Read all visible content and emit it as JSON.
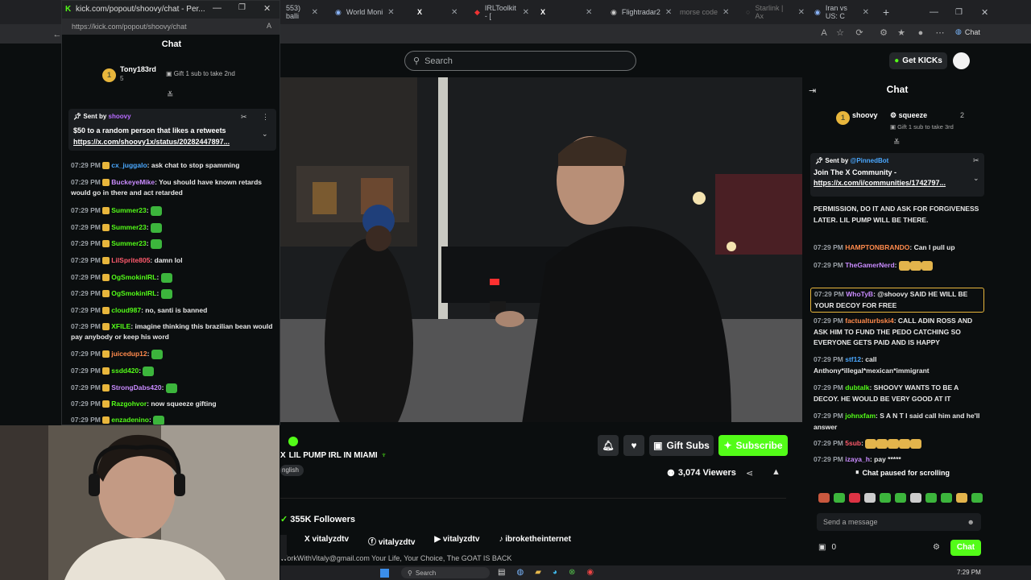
{
  "browser": {
    "tabs": [
      {
        "label": "553) balli",
        "left": 0
      },
      {
        "label": "World Moni",
        "left": 0
      },
      {
        "label": "X",
        "left": 0
      },
      {
        "label": "IRLToolkit - [",
        "left": 0
      },
      {
        "label": "X",
        "left": 0
      },
      {
        "label": "Flightradar2",
        "left": 0
      },
      {
        "label": "morse code",
        "left": 0
      },
      {
        "label": "Starlink | Ax",
        "left": 0
      },
      {
        "label": "Iran vs US: C",
        "left": 0
      }
    ],
    "new_tab": "+",
    "copilot_label": "Chat"
  },
  "popout": {
    "window_title": "kick.com/popout/shoovy/chat - Per...",
    "url": "https://kick.com/popout/shoovy/chat",
    "header": "Chat",
    "gifter": {
      "rank": "1",
      "name": "Tony183rd",
      "count": "5",
      "gift_text": "Gift 1 sub to take 2nd"
    },
    "pinned": {
      "sent_by": "Sent by",
      "sender": "shoovy",
      "message": "$50 to a random person that likes a retweets",
      "link": "https://x.com/shoovy1x/status/20282447897..."
    },
    "messages": [
      {
        "time": "07:29 PM",
        "user": "cx_juggalo",
        "text": "ask chat to stop spamming",
        "color": "b"
      },
      {
        "time": "07:29 PM",
        "user": "BuckeyeMike",
        "text": "You should have known retards would go in there and act retarded",
        "color": "p"
      },
      {
        "time": "07:29 PM",
        "user": "Summer23",
        "text": "",
        "color": "g"
      },
      {
        "time": "07:29 PM",
        "user": "Summer23",
        "text": "",
        "color": "g"
      },
      {
        "time": "07:29 PM",
        "user": "Summer23",
        "text": "",
        "color": "g"
      },
      {
        "time": "07:29 PM",
        "user": "LilSprite805",
        "text": "damn lol",
        "color": "r"
      },
      {
        "time": "07:29 PM",
        "user": "OgSmokinIRL",
        "text": "",
        "color": "g"
      },
      {
        "time": "07:29 PM",
        "user": "OgSmokinIRL",
        "text": "",
        "color": "g"
      },
      {
        "time": "07:29 PM",
        "user": "cloud987",
        "text": "no, santi is banned",
        "color": "g"
      },
      {
        "time": "07:29 PM",
        "user": "XFILE",
        "text": "imagine thinking this brazilian bean would pay anybody or keep his word",
        "color": "g"
      },
      {
        "time": "07:29 PM",
        "user": "juicedup12",
        "text": "",
        "color": "o"
      },
      {
        "time": "07:29 PM",
        "user": "ssdd420",
        "text": "",
        "color": "g"
      },
      {
        "time": "07:29 PM",
        "user": "StrongDabs420",
        "text": "",
        "color": "p"
      },
      {
        "time": "07:29 PM",
        "user": "Razgohvor",
        "text": "now squeeze gifting",
        "color": "g"
      },
      {
        "time": "07:29 PM",
        "user": "enzadenino",
        "text": "",
        "color": "g"
      }
    ]
  },
  "kick": {
    "search_placeholder": "Search",
    "get_kicks": "Get KICKs"
  },
  "stream": {
    "title": "LIL PUMP IRL IN MIAMI",
    "tag": "nglish",
    "buttons": {
      "gift_subs": "Gift Subs",
      "subscribe": "Subscribe"
    },
    "viewers": "3,074 Viewers",
    "followers": "355K Followers",
    "socials": [
      {
        "label": "vitalyzdtv",
        "icon": "x-icon"
      },
      {
        "label": "vitalyzdtv",
        "icon": "facebook-icon"
      },
      {
        "label": "vitalyzdtv",
        "icon": "youtube-icon"
      },
      {
        "label": "ibroketheinternet",
        "icon": "tiktok-icon"
      }
    ],
    "bio": "WorkWithVitaly@gmail.com Your Life, Your Choice, The GOAT IS BACK"
  },
  "chat": {
    "header": "Chat",
    "gifters": [
      {
        "rank": "1",
        "name": "shoovy",
        "count": "",
        "gift_text": ""
      },
      {
        "rank": "",
        "name": "squeeze",
        "count": "2",
        "gift_text": "Gift 1 sub to take 3rd"
      }
    ],
    "pinned": {
      "sent_by": "Sent by",
      "sender": "@PinnedBot",
      "message": "Join The X Community -",
      "link": "https://x.com/i/communities/1742797..."
    },
    "messages": [
      {
        "time": "",
        "user": "",
        "text": "PERMISSION, DO IT AND ASK FOR FORGIVENESS LATER. LIL PUMP WILL BE THERE.",
        "color": "g"
      },
      {
        "time": "07:29 PM",
        "user": "HAMPTONBRANDO",
        "text": "Can I pull up",
        "color": "o"
      },
      {
        "time": "07:29 PM",
        "user": "TheGamerNerd",
        "text": "",
        "color": "p"
      },
      {
        "time": "07:29 PM",
        "user": "WhoTyB",
        "text": "@shoovy SAID HE WILL BE YOUR DECOY FOR FREE",
        "color": "p"
      },
      {
        "time": "07:29 PM",
        "user": "factualturbski4",
        "text": "CALL ADIN ROSS AND ASK HIM TO FUND THE PEDO CATCHING SO EVERYONE GETS PAID AND IS HAPPY",
        "color": "o"
      },
      {
        "time": "07:29 PM",
        "user": "stf12",
        "text": "call Anthony*illegal*mexican*immigrant",
        "color": "b"
      },
      {
        "time": "07:29 PM",
        "user": "dubtalk",
        "text": "SHOOVY WANTS TO BE A DECOY. HE WOULD BE VERY GOOD AT IT",
        "color": "g"
      },
      {
        "time": "07:29 PM",
        "user": "johnxfam",
        "text": "S A N T I said call him and he'll answer",
        "color": "g"
      },
      {
        "time": "07:29 PM",
        "user": "5sub",
        "text": "",
        "color": "r"
      },
      {
        "time": "07:29 PM",
        "user": "izaya_h",
        "text": "pay *****",
        "color": "p"
      }
    ],
    "paused": "Chat paused for scrolling",
    "input_placeholder": "Send a message",
    "kicks_count": "0",
    "send_label": "Chat"
  },
  "taskbar": {
    "search": "Search",
    "time": "7:29 PM"
  },
  "colors": {
    "kick_green": "#53fc18",
    "bg": "#0b0e0f"
  }
}
